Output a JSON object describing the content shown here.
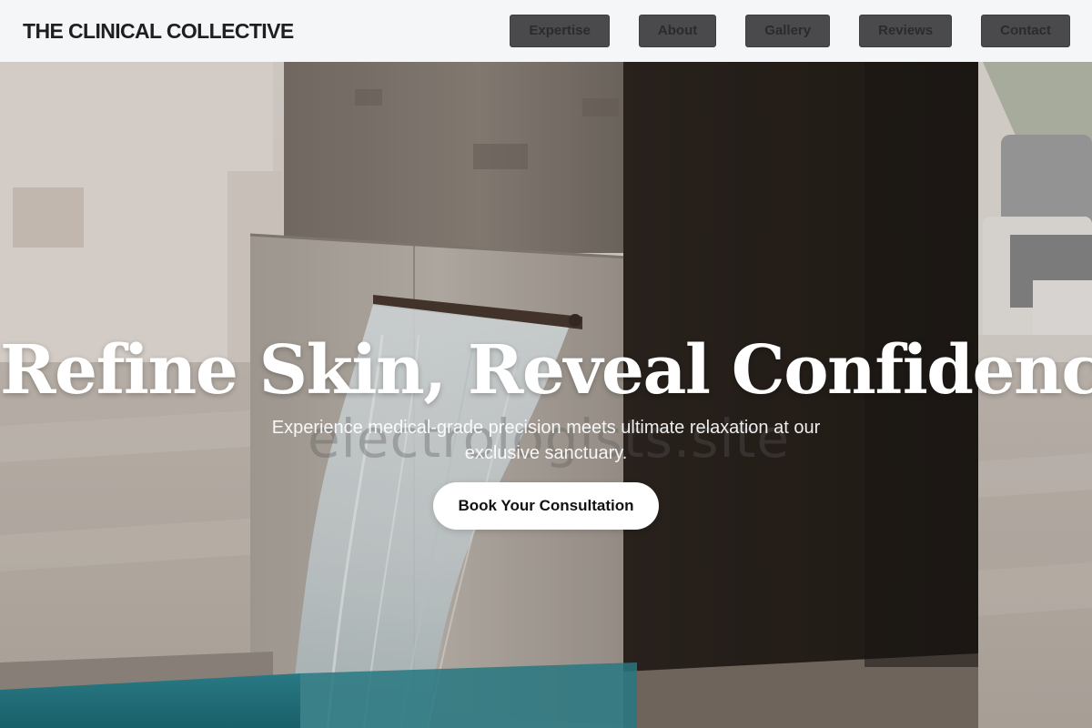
{
  "header": {
    "brand": "THE CLINICAL COLLECTIVE",
    "nav": [
      {
        "label": "Expertise"
      },
      {
        "label": "About"
      },
      {
        "label": "Gallery"
      },
      {
        "label": "Reviews"
      },
      {
        "label": "Contact"
      }
    ]
  },
  "hero": {
    "headline": "Refine Skin, Reveal Confidence.",
    "subtext": "Experience medical-grade precision meets ultimate relaxation at our exclusive sanctuary.",
    "cta_label": "Book Your Consultation",
    "watermark": "electrologists.site"
  },
  "colors": {
    "header_bg": "#f5f6f8",
    "nav_button_bg": "#4a4a4c",
    "cta_bg": "#ffffff",
    "headline": "#ffffff"
  }
}
